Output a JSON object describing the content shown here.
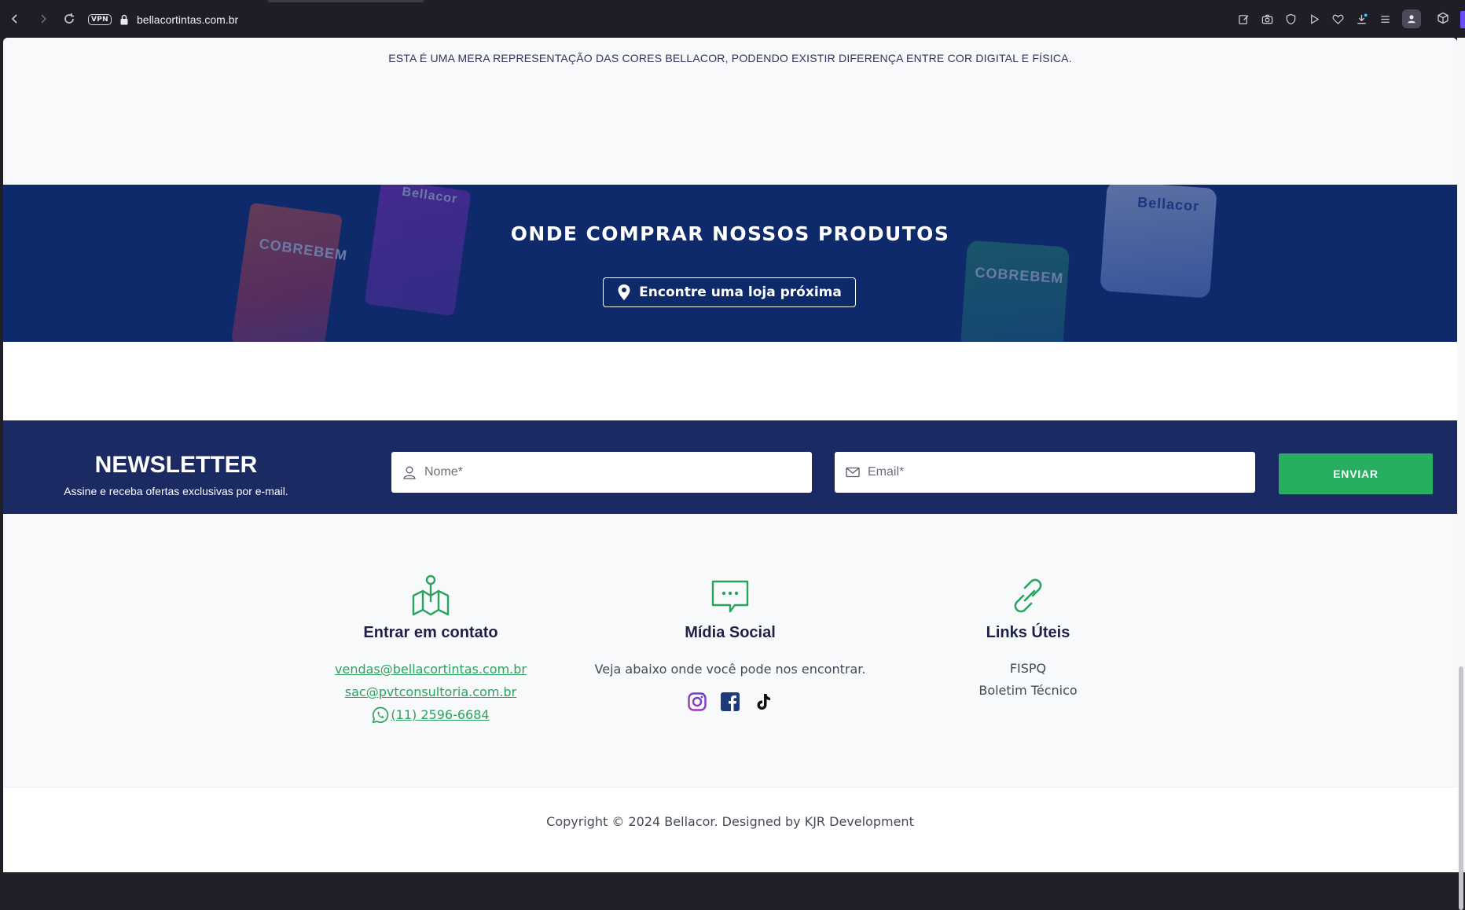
{
  "browser": {
    "url": "bellacortintas.com.br",
    "vpn_label": "VPN"
  },
  "disclaimer": "ESTA É UMA MERA REPRESENTAÇÃO DAS CORES BELLACOR, PODENDO EXISTIR DIFERENÇA ENTRE COR DIGITAL E FÍSICA.",
  "buy": {
    "title": "ONDE COMPRAR NOSSOS PRODUTOS",
    "button_label": "Encontre uma loja próxima",
    "can_labels": [
      "COBREBEM",
      "Bellacor",
      "COBREBEM",
      "Bellacor"
    ]
  },
  "newsletter": {
    "title": "NEWSLETTER",
    "subtitle": "Assine e receba ofertas exclusivas por e-mail.",
    "name_placeholder": "Nome*",
    "email_placeholder": "Email*",
    "submit_label": "ENVIAR"
  },
  "footer": {
    "contact": {
      "heading": "Entrar em contato",
      "email_1": "vendas@bellacortintas.com.br",
      "email_2": "sac@pvtconsultoria.com.br",
      "phone": "(11) 2596-6684"
    },
    "social": {
      "heading": "Mídia Social",
      "text": "Veja abaixo onde você pode nos encontrar.",
      "icons": [
        "instagram-icon",
        "facebook-icon",
        "tiktok-icon"
      ]
    },
    "links": {
      "heading": "Links Úteis",
      "items": [
        "FISPQ",
        "Boletim Técnico"
      ]
    }
  },
  "copyright": "Copyright © 2024 Bellacor. Designed by KJR Development",
  "colors": {
    "navy": "#0f2a6b",
    "newsletter_bg": "#1b2a63",
    "green": "#27ae60",
    "page_bg": "#f7f9fa"
  }
}
